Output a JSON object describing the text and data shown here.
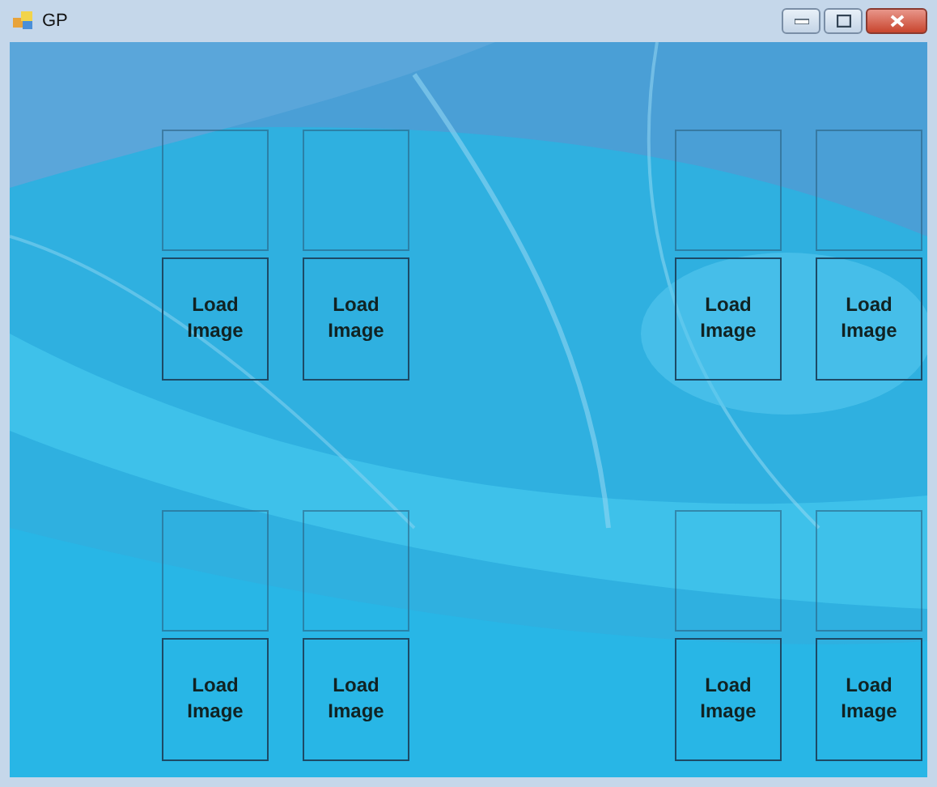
{
  "window": {
    "title": "GP"
  },
  "slots": [
    {
      "button": "Load Image"
    },
    {
      "button": "Load Image"
    },
    {
      "button": "Load Image"
    },
    {
      "button": "Load Image"
    },
    {
      "button": "Load Image"
    },
    {
      "button": "Load Image"
    },
    {
      "button": "Load Image"
    },
    {
      "button": "Load Image"
    }
  ]
}
